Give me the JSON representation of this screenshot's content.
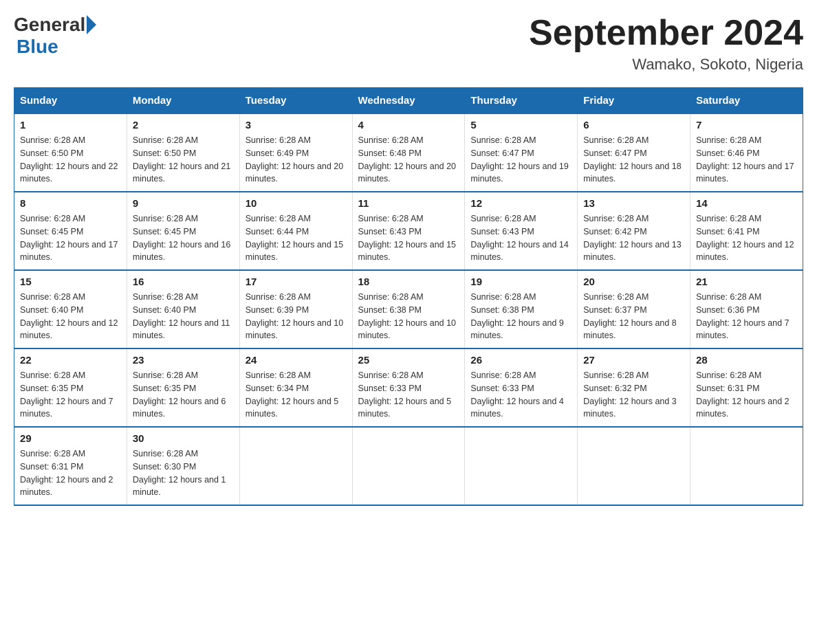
{
  "header": {
    "logo_general": "General",
    "logo_blue": "Blue",
    "month_year": "September 2024",
    "location": "Wamako, Sokoto, Nigeria"
  },
  "days_of_week": [
    "Sunday",
    "Monday",
    "Tuesday",
    "Wednesday",
    "Thursday",
    "Friday",
    "Saturday"
  ],
  "weeks": [
    [
      {
        "num": "1",
        "sunrise": "6:28 AM",
        "sunset": "6:50 PM",
        "daylight": "12 hours and 22 minutes."
      },
      {
        "num": "2",
        "sunrise": "6:28 AM",
        "sunset": "6:50 PM",
        "daylight": "12 hours and 21 minutes."
      },
      {
        "num": "3",
        "sunrise": "6:28 AM",
        "sunset": "6:49 PM",
        "daylight": "12 hours and 20 minutes."
      },
      {
        "num": "4",
        "sunrise": "6:28 AM",
        "sunset": "6:48 PM",
        "daylight": "12 hours and 20 minutes."
      },
      {
        "num": "5",
        "sunrise": "6:28 AM",
        "sunset": "6:47 PM",
        "daylight": "12 hours and 19 minutes."
      },
      {
        "num": "6",
        "sunrise": "6:28 AM",
        "sunset": "6:47 PM",
        "daylight": "12 hours and 18 minutes."
      },
      {
        "num": "7",
        "sunrise": "6:28 AM",
        "sunset": "6:46 PM",
        "daylight": "12 hours and 17 minutes."
      }
    ],
    [
      {
        "num": "8",
        "sunrise": "6:28 AM",
        "sunset": "6:45 PM",
        "daylight": "12 hours and 17 minutes."
      },
      {
        "num": "9",
        "sunrise": "6:28 AM",
        "sunset": "6:45 PM",
        "daylight": "12 hours and 16 minutes."
      },
      {
        "num": "10",
        "sunrise": "6:28 AM",
        "sunset": "6:44 PM",
        "daylight": "12 hours and 15 minutes."
      },
      {
        "num": "11",
        "sunrise": "6:28 AM",
        "sunset": "6:43 PM",
        "daylight": "12 hours and 15 minutes."
      },
      {
        "num": "12",
        "sunrise": "6:28 AM",
        "sunset": "6:43 PM",
        "daylight": "12 hours and 14 minutes."
      },
      {
        "num": "13",
        "sunrise": "6:28 AM",
        "sunset": "6:42 PM",
        "daylight": "12 hours and 13 minutes."
      },
      {
        "num": "14",
        "sunrise": "6:28 AM",
        "sunset": "6:41 PM",
        "daylight": "12 hours and 12 minutes."
      }
    ],
    [
      {
        "num": "15",
        "sunrise": "6:28 AM",
        "sunset": "6:40 PM",
        "daylight": "12 hours and 12 minutes."
      },
      {
        "num": "16",
        "sunrise": "6:28 AM",
        "sunset": "6:40 PM",
        "daylight": "12 hours and 11 minutes."
      },
      {
        "num": "17",
        "sunrise": "6:28 AM",
        "sunset": "6:39 PM",
        "daylight": "12 hours and 10 minutes."
      },
      {
        "num": "18",
        "sunrise": "6:28 AM",
        "sunset": "6:38 PM",
        "daylight": "12 hours and 10 minutes."
      },
      {
        "num": "19",
        "sunrise": "6:28 AM",
        "sunset": "6:38 PM",
        "daylight": "12 hours and 9 minutes."
      },
      {
        "num": "20",
        "sunrise": "6:28 AM",
        "sunset": "6:37 PM",
        "daylight": "12 hours and 8 minutes."
      },
      {
        "num": "21",
        "sunrise": "6:28 AM",
        "sunset": "6:36 PM",
        "daylight": "12 hours and 7 minutes."
      }
    ],
    [
      {
        "num": "22",
        "sunrise": "6:28 AM",
        "sunset": "6:35 PM",
        "daylight": "12 hours and 7 minutes."
      },
      {
        "num": "23",
        "sunrise": "6:28 AM",
        "sunset": "6:35 PM",
        "daylight": "12 hours and 6 minutes."
      },
      {
        "num": "24",
        "sunrise": "6:28 AM",
        "sunset": "6:34 PM",
        "daylight": "12 hours and 5 minutes."
      },
      {
        "num": "25",
        "sunrise": "6:28 AM",
        "sunset": "6:33 PM",
        "daylight": "12 hours and 5 minutes."
      },
      {
        "num": "26",
        "sunrise": "6:28 AM",
        "sunset": "6:33 PM",
        "daylight": "12 hours and 4 minutes."
      },
      {
        "num": "27",
        "sunrise": "6:28 AM",
        "sunset": "6:32 PM",
        "daylight": "12 hours and 3 minutes."
      },
      {
        "num": "28",
        "sunrise": "6:28 AM",
        "sunset": "6:31 PM",
        "daylight": "12 hours and 2 minutes."
      }
    ],
    [
      {
        "num": "29",
        "sunrise": "6:28 AM",
        "sunset": "6:31 PM",
        "daylight": "12 hours and 2 minutes."
      },
      {
        "num": "30",
        "sunrise": "6:28 AM",
        "sunset": "6:30 PM",
        "daylight": "12 hours and 1 minute."
      },
      null,
      null,
      null,
      null,
      null
    ]
  ],
  "labels": {
    "sunrise_prefix": "Sunrise: ",
    "sunset_prefix": "Sunset: ",
    "daylight_prefix": "Daylight: "
  }
}
